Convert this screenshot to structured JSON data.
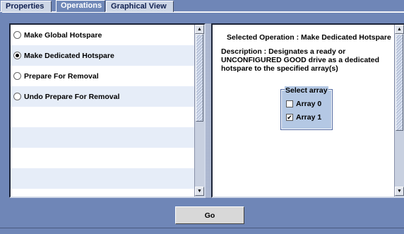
{
  "tabs": [
    {
      "label": "Properties",
      "active": false
    },
    {
      "label": "Operations",
      "active": true
    },
    {
      "label": "Graphical View",
      "active": false
    }
  ],
  "operations": [
    {
      "label": "Make Global Hotspare",
      "selected": false
    },
    {
      "label": "Make Dedicated Hotspare",
      "selected": true
    },
    {
      "label": "Prepare For Removal",
      "selected": false
    },
    {
      "label": "Undo Prepare For Removal",
      "selected": false
    }
  ],
  "detail": {
    "selected_operation": "Selected Operation : Make Dedicated Hotspare",
    "description_line1": "Description : Designates a ready or",
    "description_line2": "UNCONFIGURED GOOD drive as a dedicated",
    "description_line3": "hotspare to the specified array(s)"
  },
  "select_array": {
    "legend": "Select array",
    "arrays": [
      {
        "label": "Array 0",
        "checked": false
      },
      {
        "label": "Array 1",
        "checked": true
      }
    ]
  },
  "go_button": "Go",
  "icons": {
    "scroll_up": "arrow-up-icon",
    "scroll_down": "arrow-down-icon"
  },
  "colors": {
    "background": "#6f86b7",
    "active_tab": "#7088b8",
    "row_alt": "#e6edf8",
    "groupbox": "#b4c8e4"
  }
}
